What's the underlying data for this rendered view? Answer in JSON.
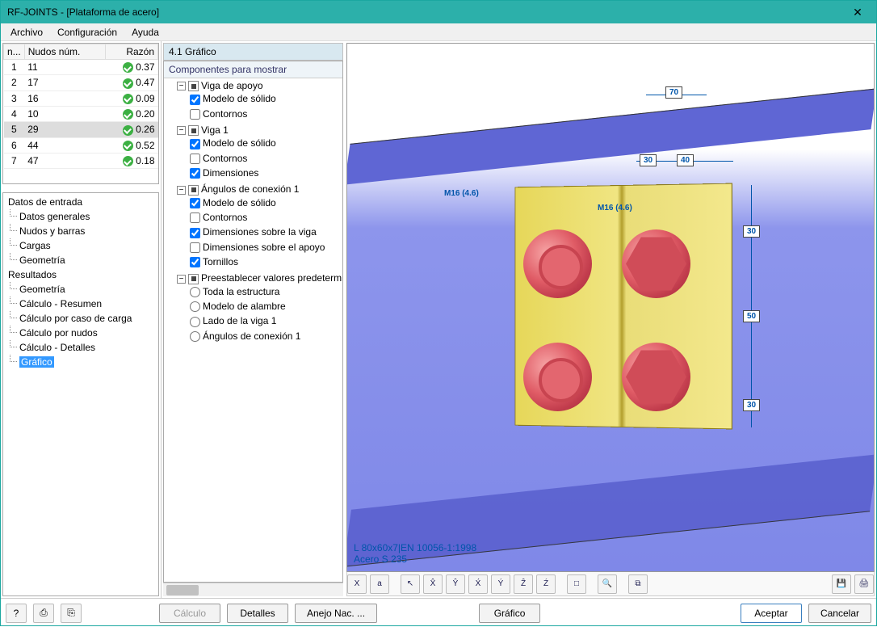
{
  "title": "RF-JOINTS - [Plataforma de acero]",
  "menu": {
    "file": "Archivo",
    "config": "Configuración",
    "help": "Ayuda"
  },
  "nodes": {
    "headers": {
      "n": "n...",
      "num": "Nudos núm.",
      "ratio": "Razón"
    },
    "rows": [
      {
        "i": "1",
        "num": "11",
        "r": "0.37"
      },
      {
        "i": "2",
        "num": "17",
        "r": "0.47"
      },
      {
        "i": "3",
        "num": "16",
        "r": "0.09"
      },
      {
        "i": "4",
        "num": "10",
        "r": "0.20"
      },
      {
        "i": "5",
        "num": "29",
        "r": "0.26"
      },
      {
        "i": "6",
        "num": "44",
        "r": "0.52"
      },
      {
        "i": "7",
        "num": "47",
        "r": "0.18"
      }
    ],
    "selected_index": 4
  },
  "nav": {
    "input": {
      "root": "Datos de entrada",
      "items": [
        "Datos generales",
        "Nudos y barras",
        "Cargas",
        "Geometría"
      ]
    },
    "results": {
      "root": "Resultados",
      "items": [
        "Geometría",
        "Cálculo - Resumen",
        "Cálculo por caso de carga",
        "Cálculo por nudos",
        "Cálculo - Detalles",
        "Gráfico"
      ],
      "selected": 5
    }
  },
  "section_title": "4.1 Gráfico",
  "tree": {
    "title": "Componentes para mostrar",
    "support_beam": {
      "label": "Viga de apoyo",
      "solid": "Modelo de sólido",
      "contours": "Contornos"
    },
    "beam1": {
      "label": "Viga 1",
      "solid": "Modelo de sólido",
      "contours": "Contornos",
      "dims": "Dimensiones"
    },
    "angles": {
      "label": "Ángulos de conexión 1",
      "solid": "Modelo de sólido",
      "contours": "Contornos",
      "dims_beam": "Dimensiones sobre la viga",
      "dims_support": "Dimensiones sobre el apoyo",
      "bolts": "Tornillos"
    },
    "presets": {
      "label": "Preestablecer valores predetermina",
      "all": "Toda la estructura",
      "wire": "Modelo de alambre",
      "side": "Lado de la viga 1",
      "angle": "Ángulos de conexión 1"
    }
  },
  "canvas": {
    "bolt1_label": "M16 (4.6)",
    "bolt2_label": "M16 (4.6)",
    "dim_70": "70",
    "dim_30a": "30",
    "dim_40": "40",
    "dim_v_30a": "30",
    "dim_v_50": "50",
    "dim_v_30b": "30",
    "material_line1": "L 80x60x7|EN 10056-1:1998",
    "material_line2": "Acero S 235"
  },
  "toolbar_icons": [
    "X",
    "a",
    "↖",
    "X̂",
    "Ŷ",
    "X́",
    "Ý",
    "Ẑ",
    "Ź",
    "□",
    "🔍",
    "⧉",
    "💾",
    "🖨"
  ],
  "footer": {
    "help": "?",
    "calc": "Cálculo",
    "details": "Detalles",
    "annex": "Anejo Nac. ...",
    "graphic": "Gráfico",
    "ok": "Aceptar",
    "cancel": "Cancelar"
  }
}
